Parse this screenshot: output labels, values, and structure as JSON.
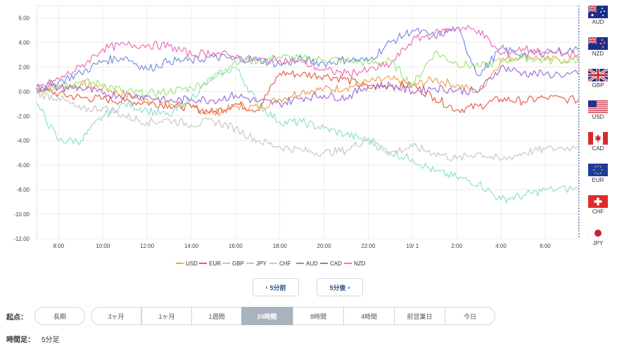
{
  "chart_data": {
    "type": "line",
    "ylim": [
      -12,
      7
    ],
    "yticks": [
      "6.00",
      "4.00",
      "2.00",
      "0.00",
      "-2.00",
      "-4.00",
      "-6.00",
      "-8.00",
      "-10.00",
      "-12.00"
    ],
    "ytick_values": [
      6,
      4,
      2,
      0,
      -2,
      -4,
      -6,
      -8,
      -10,
      -12
    ],
    "xlim": [
      7,
      31.5
    ],
    "xticks": [
      "8:00",
      "10:00",
      "12:00",
      "14:00",
      "16:00",
      "18:00",
      "20:00",
      "22:00",
      "10/ 1",
      "2:00",
      "4:00",
      "6:00"
    ],
    "xtick_values": [
      8,
      10,
      12,
      14,
      16,
      18,
      20,
      22,
      24,
      26,
      28,
      30
    ],
    "grid": true,
    "legend_position": "bottom",
    "x": [
      7,
      8,
      9,
      10,
      11,
      12,
      13,
      14,
      15,
      16,
      17,
      18,
      19,
      20,
      21,
      22,
      23,
      24,
      25,
      26,
      27,
      28,
      29,
      30,
      31.5
    ],
    "series": [
      {
        "name": "USD",
        "color": "#f0a050",
        "values": [
          0.2,
          0.3,
          0.6,
          0.3,
          -0.3,
          -0.6,
          -1.0,
          -1.3,
          -1.8,
          -1.2,
          -1.3,
          -0.6,
          0.0,
          0.2,
          0.3,
          0.8,
          1.0,
          0.5,
          1.0,
          0.5,
          0.0,
          2.5,
          3.0,
          2.6,
          2.6
        ]
      },
      {
        "name": "EUR",
        "color": "#e8604c",
        "values": [
          0.3,
          -0.2,
          -0.5,
          -0.6,
          -0.8,
          -0.9,
          -1.1,
          -1.3,
          -1.7,
          -1.0,
          -1.5,
          1.5,
          1.4,
          1.3,
          1.0,
          0.3,
          0.5,
          0.5,
          -0.5,
          -1.5,
          -1.2,
          -0.6,
          -0.8,
          -0.5,
          -0.7
        ]
      },
      {
        "name": "GBP",
        "color": "#9be87a",
        "values": [
          0.0,
          0.5,
          0.8,
          0.6,
          0.0,
          -0.2,
          0.0,
          0.3,
          1.0,
          2.5,
          2.5,
          2.8,
          2.7,
          2.6,
          2.6,
          2.3,
          2.5,
          0.5,
          3.2,
          2.3,
          2.0,
          2.5,
          2.8,
          2.5,
          2.6
        ]
      },
      {
        "name": "JPY",
        "color": "#8fe0cf",
        "values": [
          -1.0,
          -4.0,
          -4.0,
          -2.0,
          -1.0,
          -1.5,
          -2.0,
          -0.5,
          1.2,
          2.0,
          -1.0,
          -2.5,
          -2.5,
          -3.0,
          -3.5,
          -4.0,
          -5.0,
          -5.5,
          -6.5,
          -7.0,
          -7.5,
          -8.8,
          -8.5,
          -8.0,
          -7.9
        ]
      },
      {
        "name": "CHF",
        "color": "#c8c8c8",
        "values": [
          -0.2,
          -0.5,
          -1.5,
          -1.3,
          -2.0,
          -2.5,
          -2.3,
          -2.7,
          -2.4,
          -3.0,
          -4.0,
          -4.5,
          -4.8,
          -5.0,
          -4.8,
          -3.8,
          -5.0,
          -4.5,
          -5.0,
          -5.5,
          -5.0,
          -5.6,
          -5.0,
          -4.7,
          -4.5
        ]
      },
      {
        "name": "AUD",
        "color": "#7890e0",
        "values": [
          0.1,
          0.8,
          1.5,
          2.5,
          2.8,
          1.8,
          2.5,
          2.5,
          2.8,
          2.7,
          2.6,
          2.2,
          2.6,
          2.3,
          2.6,
          2.5,
          4.0,
          5.0,
          4.5,
          5.2,
          1.3,
          3.5,
          3.0,
          3.2,
          3.4
        ]
      },
      {
        "name": "CAD",
        "color": "#a070d8",
        "values": [
          0.5,
          0.3,
          0.3,
          -0.2,
          -0.3,
          -0.4,
          -0.8,
          -0.6,
          -0.7,
          -0.3,
          -0.8,
          -1.0,
          -0.5,
          -0.3,
          -0.5,
          0.5,
          0.5,
          0.0,
          0.3,
          0.1,
          0.0,
          2.0,
          1.5,
          1.4,
          1.4
        ]
      },
      {
        "name": "NZD",
        "color": "#f070b8",
        "values": [
          0.2,
          1.0,
          2.0,
          3.5,
          3.8,
          3.8,
          3.7,
          3.0,
          3.2,
          2.8,
          2.5,
          2.6,
          2.4,
          1.7,
          1.5,
          1.7,
          2.2,
          4.2,
          4.7,
          5.2,
          5.0,
          3.0,
          3.5,
          3.2,
          3.0
        ]
      }
    ]
  },
  "flags": [
    {
      "icon": "australia-flag-icon",
      "label": "AUD"
    },
    {
      "icon": "new-zealand-flag-icon",
      "label": "NZD"
    },
    {
      "icon": "uk-flag-icon",
      "label": "GBP"
    },
    {
      "icon": "us-flag-icon",
      "label": "USD"
    },
    {
      "icon": "canada-flag-icon",
      "label": "CAD"
    },
    {
      "icon": "eu-flag-icon",
      "label": "EUR"
    },
    {
      "icon": "swiss-flag-icon",
      "label": "CHF"
    },
    {
      "icon": "japan-flag-icon",
      "label": "JPY"
    }
  ],
  "nav": {
    "prev_label": "5分前",
    "next_label": "5分後"
  },
  "period": {
    "label": "起点：",
    "tabs": [
      {
        "label": "長期",
        "active": false
      },
      {
        "label": "3ヶ月",
        "active": false
      },
      {
        "label": "1ヶ月",
        "active": false
      },
      {
        "label": "1週間",
        "active": false
      },
      {
        "label": "24時間",
        "active": true
      },
      {
        "label": "8時間",
        "active": false
      },
      {
        "label": "4時間",
        "active": false
      },
      {
        "label": "前営業日",
        "active": false
      },
      {
        "label": "今日",
        "active": false
      }
    ]
  },
  "timeframe": {
    "label": "時間足：",
    "value": "5分足"
  }
}
